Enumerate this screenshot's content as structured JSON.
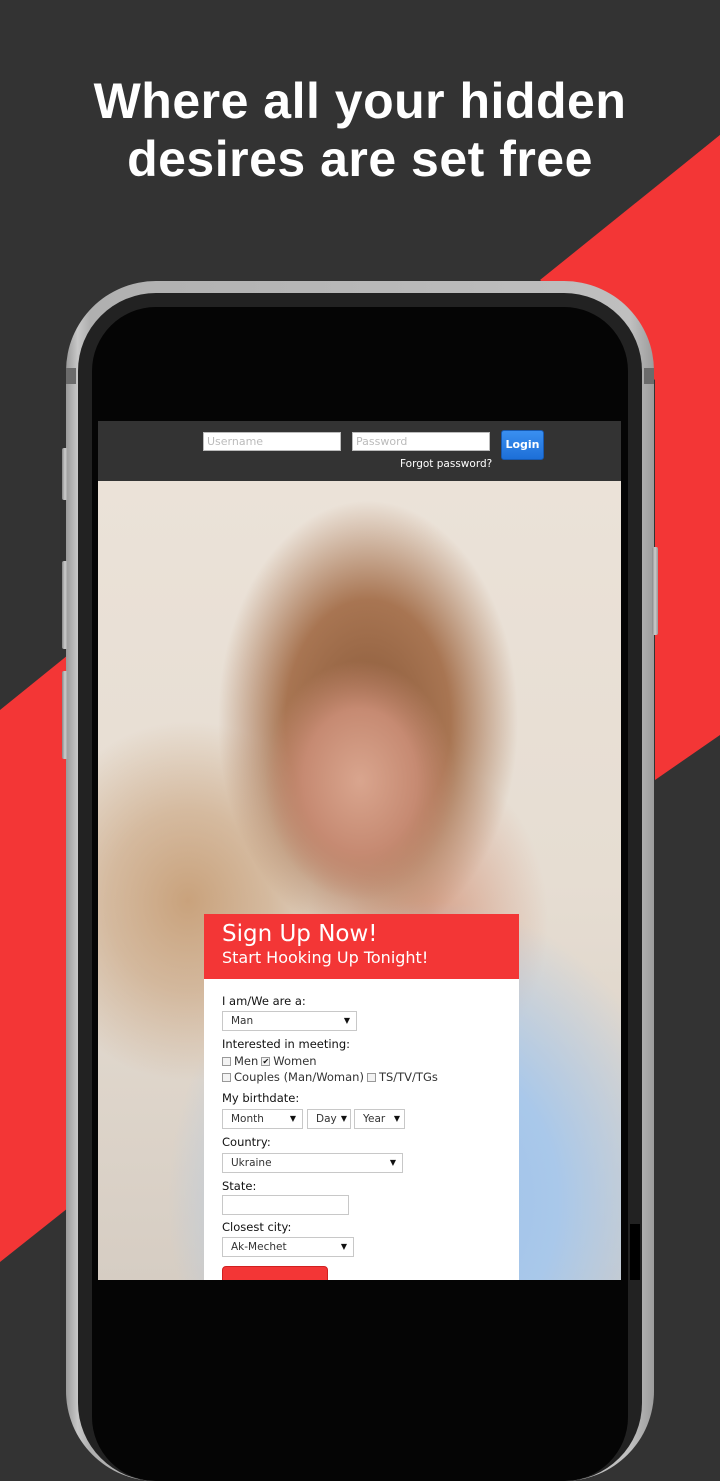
{
  "promo": {
    "headline_line1": "Where all your hidden",
    "headline_line2": "desires are set free",
    "colors": {
      "background": "#333333",
      "accent": "#f33636"
    }
  },
  "login_bar": {
    "username_placeholder": "Username",
    "password_placeholder": "Password",
    "login_label": "Login",
    "forgot_password": "Forgot password?"
  },
  "signup": {
    "title": "Sign Up Now!",
    "subtitle": "Start Hooking Up Tonight!",
    "i_am_label": "I am/We are a:",
    "i_am_value": "Man",
    "interested_label": "Interested in meeting:",
    "interests": [
      {
        "label": "Men",
        "checked": false
      },
      {
        "label": "Women",
        "checked": true
      },
      {
        "label": "Couples (Man/Woman)",
        "checked": false
      },
      {
        "label": "TS/TV/TGs",
        "checked": false
      }
    ],
    "birthdate_label": "My birthdate:",
    "month_value": "Month",
    "day_value": "Day",
    "year_value": "Year",
    "country_label": "Country:",
    "country_value": "Ukraine",
    "state_label": "State:",
    "state_value": "",
    "city_label": "Closest city:",
    "city_value": "Ak-Mechet",
    "dropdown_arrow": "▼",
    "checkmark": "✔"
  }
}
